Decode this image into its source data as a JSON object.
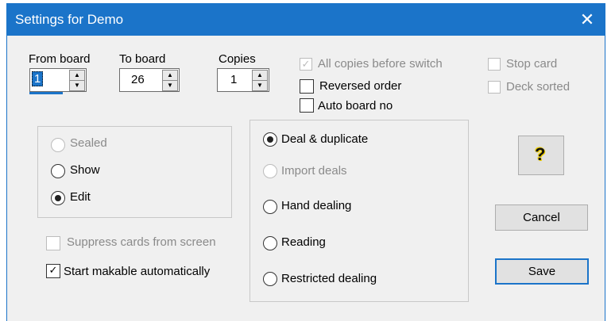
{
  "window": {
    "title": "Settings for Demo",
    "close_glyph": "✕"
  },
  "fields": {
    "from_board": {
      "label": "From board",
      "value": "1"
    },
    "to_board": {
      "label": "To board",
      "value": "26"
    },
    "copies": {
      "label": "Copies",
      "value": "1"
    }
  },
  "options": {
    "all_copies": {
      "label": "All copies before switch",
      "checked": true,
      "enabled": false
    },
    "reversed_order": {
      "label": "Reversed order",
      "checked": false,
      "enabled": true
    },
    "auto_board_no": {
      "label": "Auto board no",
      "checked": false,
      "enabled": true
    },
    "stop_card": {
      "label": "Stop card",
      "checked": false,
      "enabled": false
    },
    "deck_sorted": {
      "label": "Deck sorted",
      "checked": false,
      "enabled": false
    },
    "suppress_cards": {
      "label": "Suppress cards from screen",
      "checked": false,
      "enabled": false
    },
    "start_makable": {
      "label": "Start makable automatically",
      "checked": true,
      "enabled": true
    }
  },
  "view_mode": [
    {
      "label": "Sealed",
      "selected": false,
      "enabled": false
    },
    {
      "label": "Show",
      "selected": false,
      "enabled": true
    },
    {
      "label": "Edit",
      "selected": true,
      "enabled": true
    }
  ],
  "deal_mode": [
    {
      "label": "Deal & duplicate",
      "selected": true,
      "enabled": true
    },
    {
      "label": "Import deals",
      "selected": false,
      "enabled": false
    },
    {
      "label": "Hand dealing",
      "selected": false,
      "enabled": true
    },
    {
      "label": "Reading",
      "selected": false,
      "enabled": true
    },
    {
      "label": "Restricted dealing",
      "selected": false,
      "enabled": true
    }
  ],
  "buttons": {
    "help_icon": "question-icon",
    "help_glyph": "?",
    "cancel": "Cancel",
    "save": "Save"
  },
  "icons": {
    "check_glyph": "✓",
    "up_glyph": "▲",
    "down_glyph": "▼"
  },
  "colors": {
    "accent": "#1b74c9",
    "disabled_text": "#8a8a8a"
  }
}
